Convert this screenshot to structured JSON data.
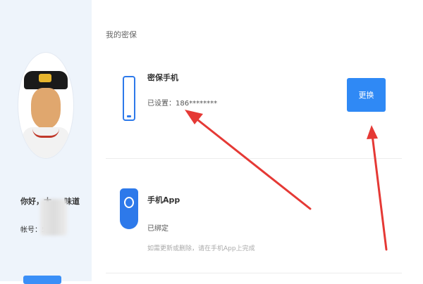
{
  "sidebar": {
    "greeting": "你好，太",
    "greeting_tail": "味道",
    "account_label": "帐号：5"
  },
  "main": {
    "section_title": "我的密保",
    "items": [
      {
        "title": "密保手机",
        "status": "已设置：186********",
        "button_label": "更换",
        "icon": "phone-icon"
      },
      {
        "title": "手机App",
        "status": "已绑定",
        "note": "如需更新或删除，请在手机App上完成",
        "icon": "shield-icon"
      }
    ]
  },
  "colors": {
    "accent": "#2f89f5",
    "arrow": "#e53935",
    "sidebar_bg": "#eef4fb"
  }
}
